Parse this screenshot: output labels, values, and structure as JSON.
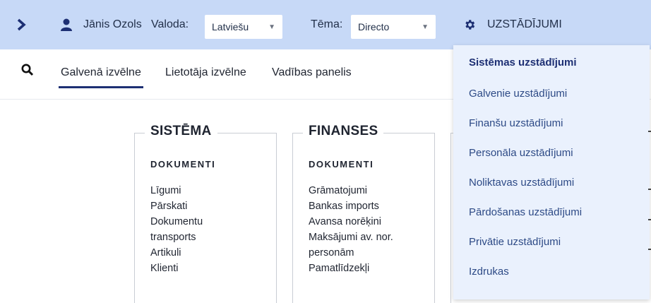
{
  "topbar": {
    "user_name": "Jānis Ozols",
    "language_label": "Valoda:",
    "language_value": "Latviešu",
    "theme_label": "Tēma:",
    "theme_value": "Directo",
    "settings_label": "UZSTĀDĪJUMI"
  },
  "nav": {
    "tabs": [
      {
        "label": "Galvenā izvēlne"
      },
      {
        "label": "Lietotāja izvēlne"
      },
      {
        "label": "Vadības panelis"
      }
    ]
  },
  "modules": [
    {
      "title": "SISTĒMA",
      "section": "DOKUMENTI",
      "links": [
        "Līgumi",
        "Pārskati",
        "Dokumentu",
        "transports",
        "Artikuli",
        "Klienti"
      ]
    },
    {
      "title": "FINANSES",
      "section": "DOKUMENTI",
      "links": [
        "Grāmatojumi",
        "Bankas imports",
        "Avansa norēķini",
        "Maksājumi av. nor.",
        "personām",
        "Pamatlīdzekļi"
      ]
    }
  ],
  "settings_menu": {
    "items": [
      "Sistēmas uzstādījumi",
      "Galvenie uzstādījumi",
      "Finanšu uzstādījumi",
      "Personāla uzstādījumi",
      "Noliktavas uzstādījumi",
      "Pārdošanas uzstādījumi",
      "Privātie uzstādījumi",
      "Izdrukas"
    ],
    "selected_index": 0
  },
  "colors": {
    "topbar_bg": "#c7d9f7",
    "accent": "#1d2f73",
    "dropdown_bg": "#eaf1fd"
  }
}
